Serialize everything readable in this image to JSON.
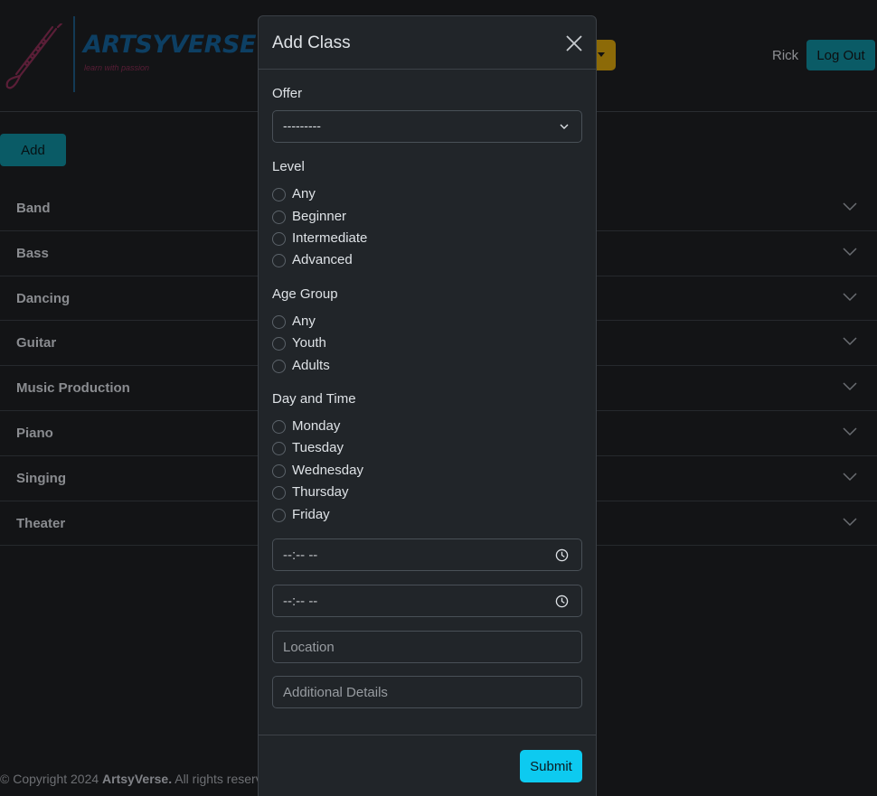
{
  "header": {
    "logo_title": "ARTSYVERSE",
    "logo_tagline": "learn with passion",
    "user_name": "Rick",
    "logout_label": "Log Out"
  },
  "toolbar": {
    "add_label": "Add"
  },
  "categories": [
    {
      "label": "Band"
    },
    {
      "label": "Bass"
    },
    {
      "label": "Dancing"
    },
    {
      "label": "Guitar"
    },
    {
      "label": "Music Production"
    },
    {
      "label": "Piano"
    },
    {
      "label": "Singing"
    },
    {
      "label": "Theater"
    }
  ],
  "footer": {
    "prefix": "© Copyright 2024 ",
    "brand": "ArtsyVerse.",
    "suffix": " All rights reserv"
  },
  "modal": {
    "title": "Add Class",
    "offer": {
      "label": "Offer",
      "selected": "---------"
    },
    "level": {
      "label": "Level",
      "options": [
        "Any",
        "Beginner",
        "Intermediate",
        "Advanced"
      ]
    },
    "age_group": {
      "label": "Age Group",
      "options": [
        "Any",
        "Youth",
        "Adults"
      ]
    },
    "day_time": {
      "label": "Day and Time",
      "options": [
        "Monday",
        "Tuesday",
        "Wednesday",
        "Thursday",
        "Friday"
      ],
      "start_time": "--:-- --",
      "end_time": "--:-- --"
    },
    "location_placeholder": "Location",
    "details_placeholder": "Additional Details",
    "submit_label": "Submit"
  },
  "colors": {
    "accent": "#0dcaf0",
    "modal_bg": "#212529",
    "page_bg": "#131416",
    "warning_dim": "#8c6a08"
  }
}
